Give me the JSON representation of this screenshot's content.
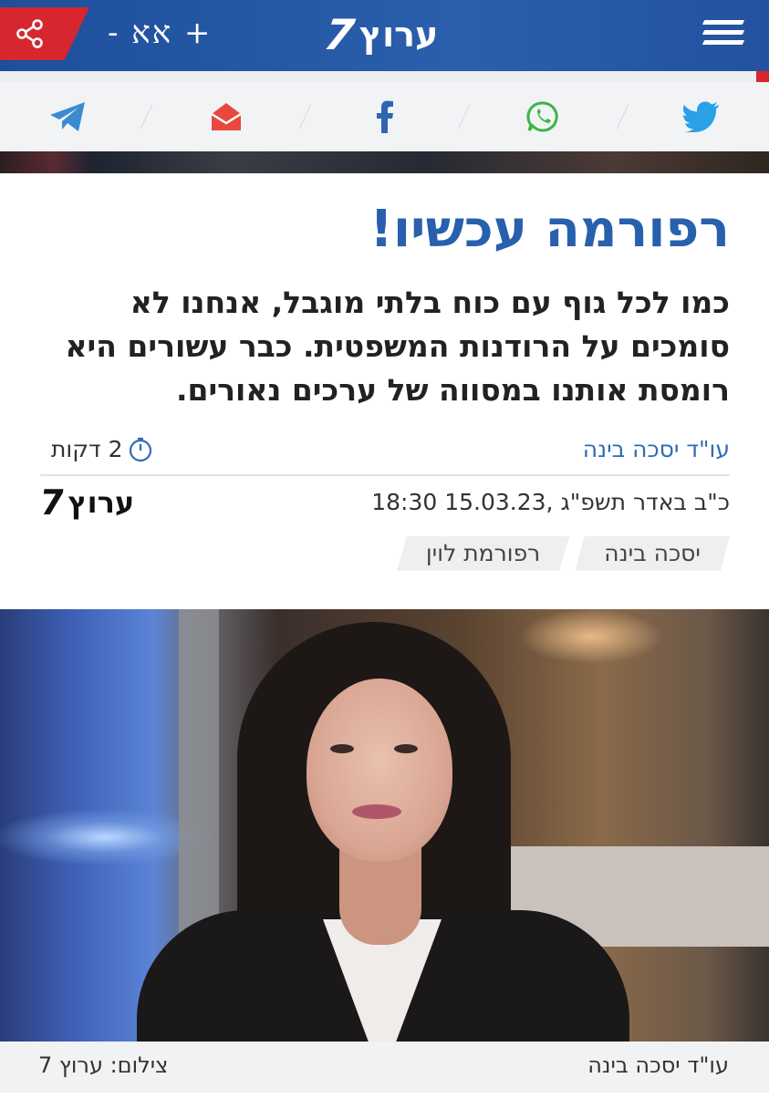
{
  "header": {
    "font_size_control": "- אא +",
    "logo_number": "7",
    "logo_word": "ערוץ",
    "share_icon": "share-icon",
    "menu_icon": "hamburger-menu-icon",
    "colors": {
      "bar": "#2b5fab",
      "share_tab": "#d7262e"
    }
  },
  "share_bar": {
    "icons": [
      "telegram-icon",
      "email-icon",
      "facebook-icon",
      "whatsapp-icon",
      "twitter-icon"
    ],
    "colors": {
      "telegram": "#3a8bd1",
      "email": "#e8483e",
      "facebook": "#2f66b3",
      "whatsapp": "#3cb34a",
      "twitter": "#2aa1e6"
    }
  },
  "article": {
    "headline": "רפורמה עכשיו!",
    "subtitle": "כמו לכל גוף עם כוח בלתי מוגבל, אנחנו לא סומכים על הרודנות המשפטית. כבר עשורים היא רומסת אותנו במסווה של ערכים נאורים.",
    "author": "עו\"ד יסכה בינה",
    "read_time": "2 דקות",
    "date": "כ\"ב באדר תשפ\"ג  ,15.03.23 18:30",
    "tags": [
      "יסכה בינה",
      "רפורמת לוין"
    ],
    "colors": {
      "headline": "#2860ad",
      "author_link": "#2f6cb6"
    }
  },
  "photo": {
    "caption_name": "עו\"ד יסכה בינה",
    "caption_credit": "צילום: ערוץ 7"
  },
  "footer_logo": {
    "number": "7",
    "word": "ערוץ"
  }
}
